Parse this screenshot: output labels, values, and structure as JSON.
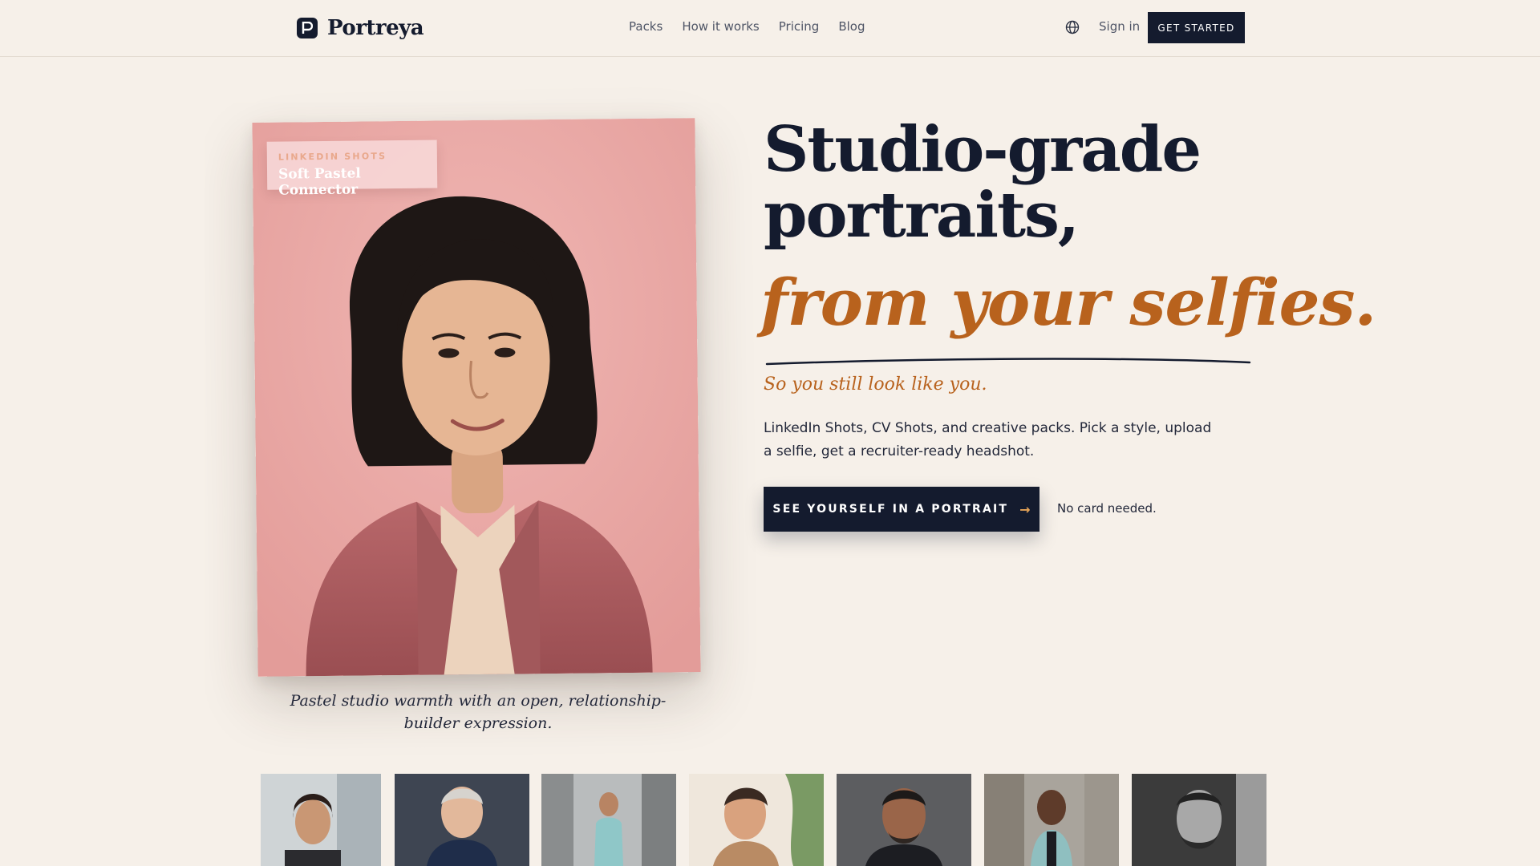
{
  "nav": {
    "brand": "Portreya",
    "links": [
      "Packs",
      "How it works",
      "Pricing",
      "Blog"
    ],
    "language_icon": "globe-icon",
    "sign_in": "Sign in",
    "cta": "GET STARTED"
  },
  "hero_card": {
    "eyebrow": "LINKEDIN SHOTS",
    "title": "Soft Pastel Connector",
    "caption": "Pastel studio warmth with an open, relationship-builder expression."
  },
  "hero": {
    "headline": "Studio-grade portraits,",
    "headline_accent": "from your selfies.",
    "tagline": "So you still look like you.",
    "lead": "LinkedIn Shots, CV Shots, and creative packs. Pick a style, upload a selfie, get a recruiter-ready headshot.",
    "cta_label": "SEE YOURSELF IN A PORTRAIT",
    "cta_icon": "arrow-right-icon",
    "cta_note": "No card needed."
  },
  "colors": {
    "background": "#f6f0e9",
    "ink": "#141b2e",
    "accent": "#b8621d",
    "card_bg": "#ecaaa7"
  }
}
